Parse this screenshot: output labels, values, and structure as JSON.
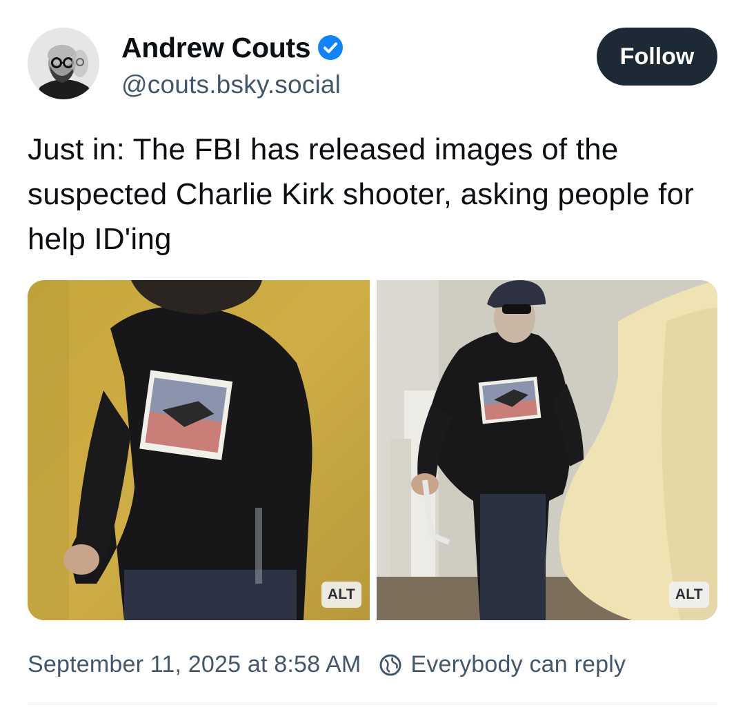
{
  "author": {
    "display_name": "Andrew Couts",
    "handle": "@couts.bsky.social",
    "avatar_icon": "avatar",
    "verified_icon": "verified-check-icon",
    "verified_color": "#1083fe"
  },
  "actions": {
    "follow_label": "Follow"
  },
  "post": {
    "text": "Just in: The FBI has released images of the suspected Charlie Kirk shooter, asking people for help ID'ing"
  },
  "media": {
    "images": [
      {
        "alt_label": "ALT"
      },
      {
        "alt_label": "ALT"
      }
    ]
  },
  "meta": {
    "timestamp": "September 11, 2025 at 8:58 AM",
    "reply_setting_icon": "globe-icon",
    "reply_setting": "Everybody can reply"
  },
  "colors": {
    "follow_button_bg": "#1e2936",
    "secondary_text": "#42576c"
  }
}
